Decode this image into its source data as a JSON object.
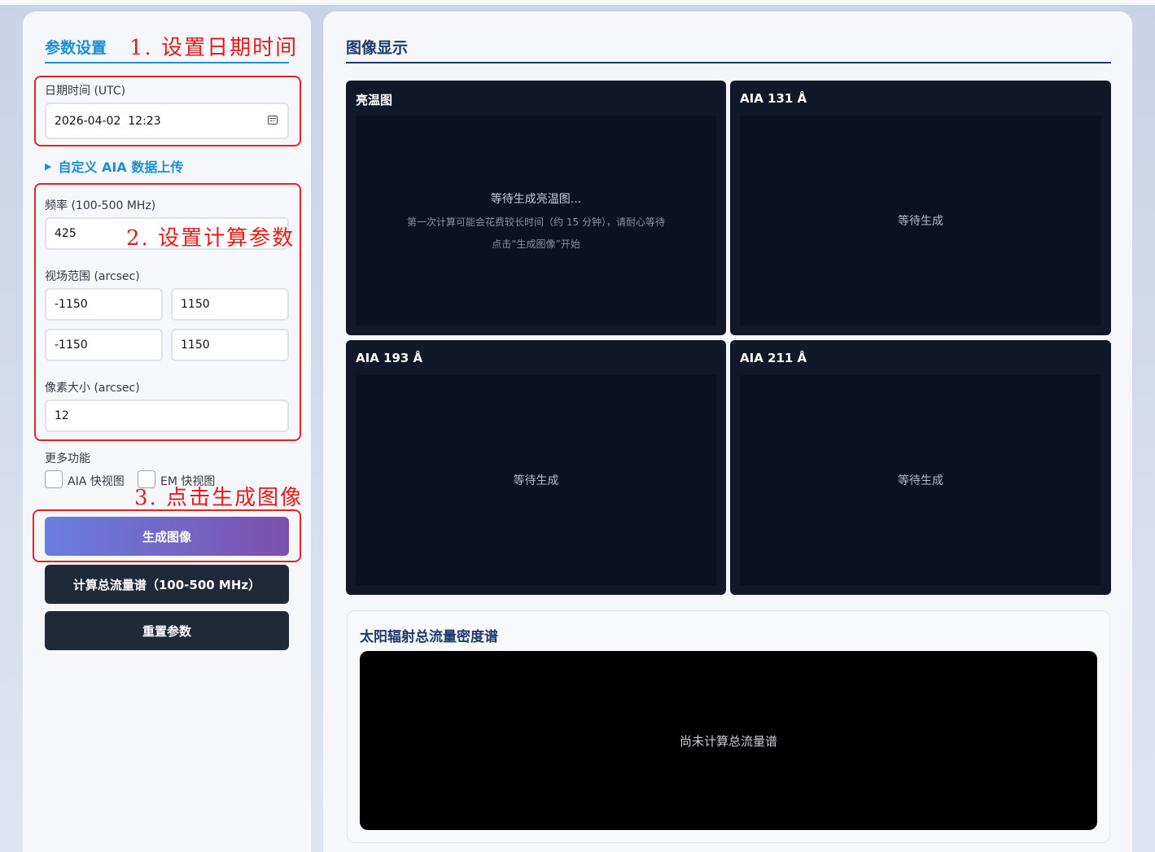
{
  "left": {
    "title": "参数设置",
    "datetime": {
      "label": "日期时间 (UTC)",
      "value": "2026-04-02  12:23"
    },
    "upload_toggle": "自定义 AIA 数据上传",
    "frequency": {
      "label": "频率 (100-500 MHz)",
      "value": "425"
    },
    "fov": {
      "label": "视场范围 (arcsec)",
      "x_min": "-1150",
      "x_max": "1150",
      "y_min": "-1150",
      "y_max": "1150"
    },
    "pixel": {
      "label": "像素大小 (arcsec)",
      "value": "12"
    },
    "more": {
      "label": "更多功能",
      "options": [
        {
          "label": "AIA 快视图",
          "checked": false
        },
        {
          "label": "EM 快视图",
          "checked": false
        }
      ]
    },
    "buttons": {
      "generate": "生成图像",
      "spectrum": "计算总流量谱（100-500 MHz）",
      "reset": "重置参数"
    }
  },
  "annotations": {
    "step1": "1. 设置日期时间",
    "step2": "2. 设置计算参数",
    "step3": "3. 点击生成图像"
  },
  "right": {
    "title": "图像显示",
    "cards": [
      {
        "title": "亮温图",
        "main": "等待生成亮温图...",
        "sub": "第一次计算可能会花费较长时间（约 15 分钟），请耐心等待",
        "hint": "点击“生成图像”开始"
      },
      {
        "title": "AIA 131 Å",
        "main": "等待生成"
      },
      {
        "title": "AIA 193 Å",
        "main": "等待生成"
      },
      {
        "title": "AIA 211 Å",
        "main": "等待生成"
      }
    ],
    "spectrum": {
      "title": "太阳辐射总流量密度谱",
      "placeholder": "尚未计算总流量谱"
    }
  },
  "colors": {
    "accent_blue": "#1b8fd8",
    "annotation_red": "#e0242a",
    "dark_button": "#1f2937",
    "gradient_start": "#6a7ee0",
    "gradient_end": "#7c50ae"
  }
}
